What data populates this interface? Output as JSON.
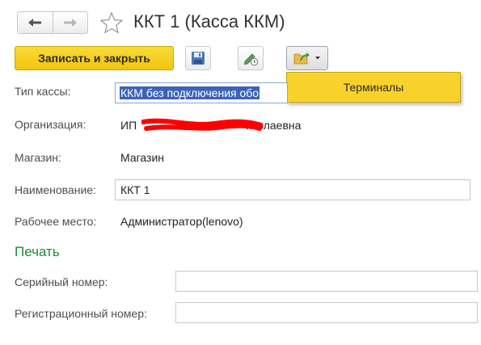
{
  "window": {
    "title": "ККТ 1 (Касса ККМ)"
  },
  "toolbar": {
    "save_close_label": "Записать и закрыть",
    "save_icon": "floppy-disk-icon",
    "edit_icon": "edit-pencil-clock-icon",
    "more_icon": "folder-arrow-icon"
  },
  "menu": {
    "items": [
      {
        "label": "Терминалы"
      }
    ]
  },
  "form": {
    "cash_type": {
      "label": "Тип кассы:",
      "value": "ККМ без подключения обо"
    },
    "organization": {
      "label": "Организация:",
      "value_prefix": "ИП",
      "value_suffix": "иколаевна"
    },
    "store": {
      "label": "Магазин:",
      "value": "Магазин"
    },
    "name": {
      "label": "Наименование:",
      "value": "ККТ 1"
    },
    "workplace": {
      "label": "Рабочее место:",
      "value": "Администратор(lenovo)"
    }
  },
  "print": {
    "section_title": "Печать",
    "serial": {
      "label": "Серийный номер:",
      "value": ""
    },
    "registration": {
      "label": "Регистрационный номер:",
      "value": ""
    }
  },
  "colors": {
    "accent_yellow": "#f8d22a",
    "selection_blue": "#3d63b8",
    "section_green": "#1f8a34",
    "redaction_red": "#ff0000"
  }
}
